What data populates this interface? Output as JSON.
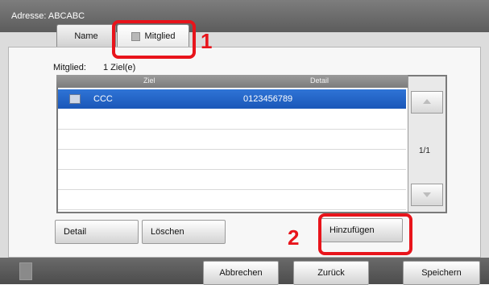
{
  "header": {
    "address_label": "Adresse:",
    "address_value": "ABCABC"
  },
  "tabs": [
    {
      "label": "Name"
    },
    {
      "label": "Mitglied"
    }
  ],
  "member": {
    "count_label": "Mitglied:",
    "count_value": "1 Ziel(e)"
  },
  "table": {
    "columns": [
      "Ziel",
      "Detail"
    ],
    "rows": [
      {
        "name": "CCC",
        "detail": "0123456789"
      }
    ],
    "page_indicator": "1/1"
  },
  "actions": {
    "detail": "Detail",
    "delete": "Löschen",
    "add": "Hinzufügen"
  },
  "footer": {
    "cancel": "Abbrechen",
    "back": "Zurück",
    "save": "Speichern"
  },
  "callouts": {
    "one": "1",
    "two": "2",
    "color": "#e8141b"
  },
  "colors": {
    "selection": "#1a57b8"
  },
  "icons": {
    "tab_member": "contact-card-icon",
    "row": "contact-icon",
    "scroll_up": "chevron-up-icon",
    "scroll_down": "chevron-down-icon"
  }
}
